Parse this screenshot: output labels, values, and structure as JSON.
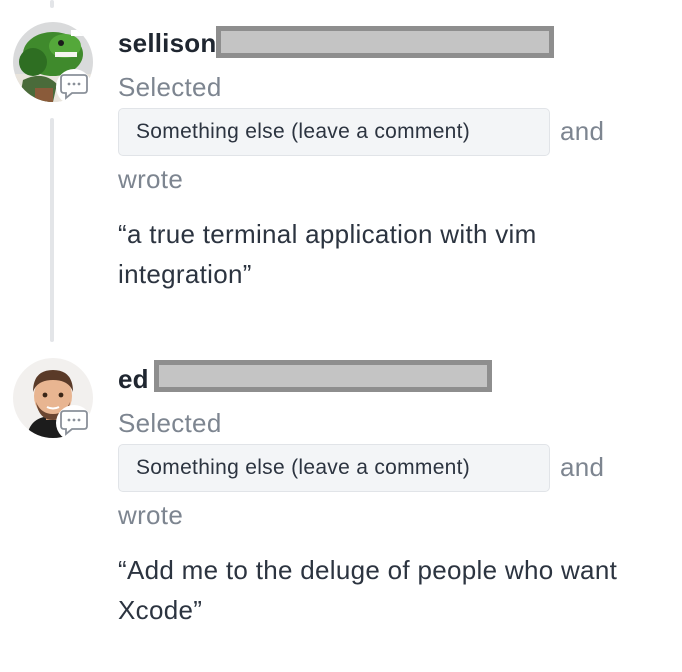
{
  "comments": [
    {
      "username": "sellison",
      "action": "Selected",
      "option": "Something else (leave a comment)",
      "conjunction": "and",
      "verb": "wrote",
      "text": "“a true terminal application with vim integration”",
      "avatar": "green-cartoon-avatar",
      "badge_icon": "comment-bubble-icon"
    },
    {
      "username": "ed",
      "action": "Selected",
      "option": "Something else (leave a comment)",
      "conjunction": "and",
      "verb": "wrote",
      "text": "“Add me to the deluge of people who want Xcode”",
      "avatar": "memoji-avatar",
      "badge_icon": "comment-bubble-icon"
    }
  ],
  "colors": {
    "username": "#1f2630",
    "muted": "#7d8590",
    "chip_bg": "#f3f5f7",
    "redaction_fill": "#c4c4c4",
    "redaction_border": "#8e8e8e",
    "thread_line": "#e3e5e8"
  }
}
